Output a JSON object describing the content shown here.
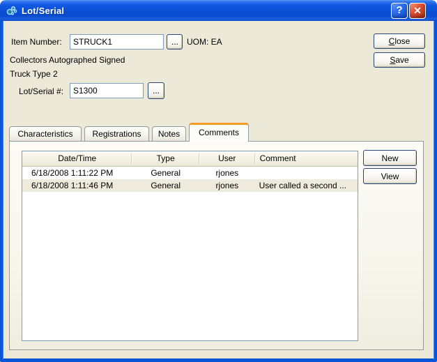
{
  "window": {
    "title": "Lot/Serial"
  },
  "titlebar": {
    "help_glyph": "?",
    "close_glyph": "✕"
  },
  "form": {
    "item_number_label": "Item Number:",
    "item_number_value": "STRUCK1",
    "item_browse_label": "...",
    "uom_label": "UOM: EA",
    "description_line1": "Collectors Autographed Signed",
    "description_line2": "Truck Type 2",
    "lot_serial_label": "Lot/Serial #:",
    "lot_serial_value": "S1300",
    "lot_browse_label": "..."
  },
  "actions": {
    "close_label": "Close",
    "save_label": "Save"
  },
  "tabs": [
    {
      "label": "Characteristics",
      "active": false
    },
    {
      "label": "Registrations",
      "active": false
    },
    {
      "label": "Notes",
      "active": false
    },
    {
      "label": "Comments",
      "active": true
    }
  ],
  "comments": {
    "columns": [
      "Date/Time",
      "Type",
      "User",
      "Comment"
    ],
    "rows": [
      [
        "6/18/2008 1:11:22 PM",
        "General",
        "rjones",
        ""
      ],
      [
        "6/18/2008 1:11:46 PM",
        "General",
        "rjones",
        "User called a second ..."
      ]
    ],
    "new_label": "New",
    "view_label": "View"
  },
  "colors": {
    "titlebar_blue": "#0b55da",
    "window_beige": "#ece9d8",
    "active_tab_orange": "#f49b21",
    "close_button_red": "#d6492a",
    "alt_row_beige": "#eeebdc",
    "field_border": "#7f9db9"
  }
}
